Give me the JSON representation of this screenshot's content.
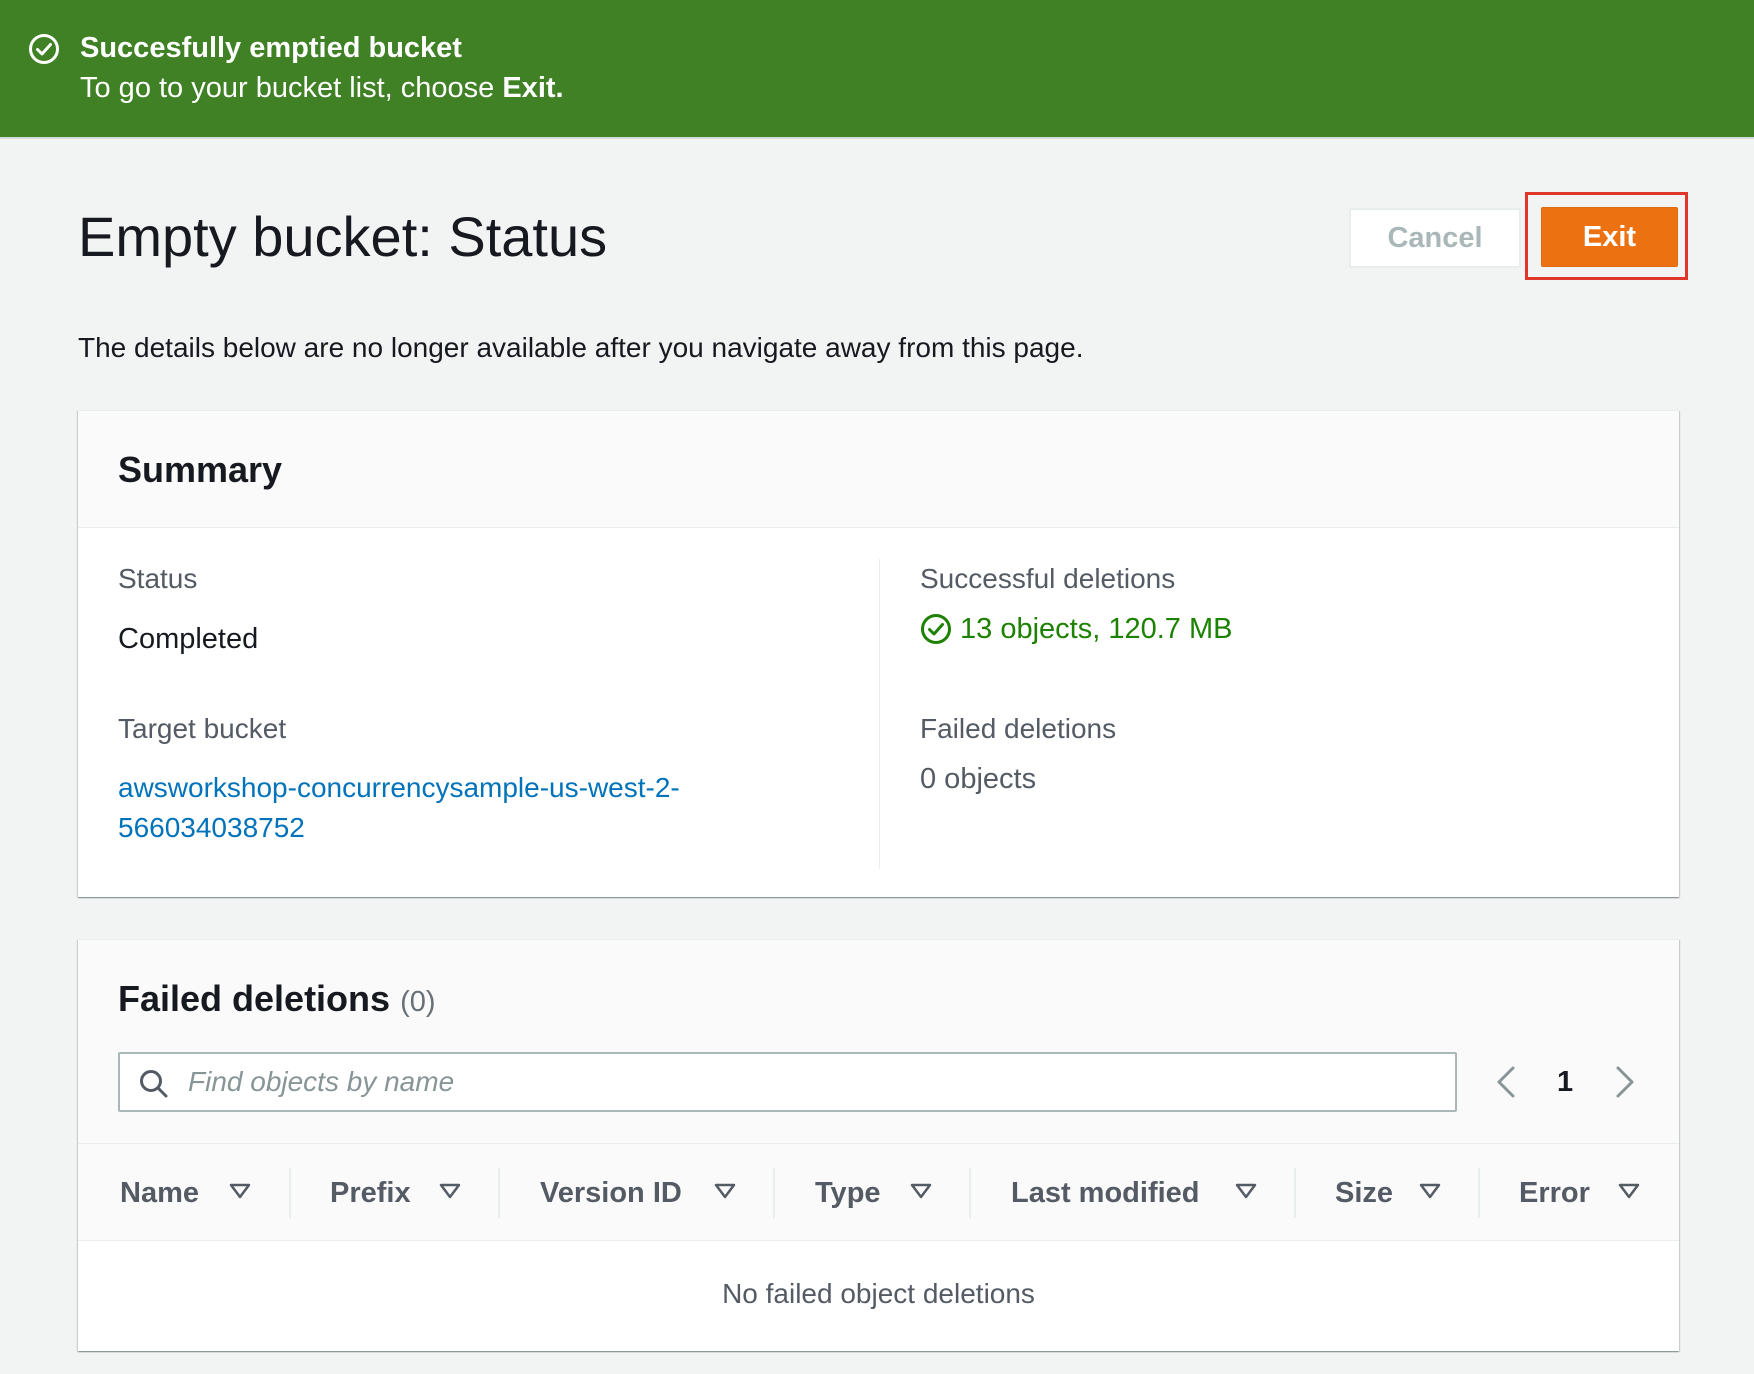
{
  "flash": {
    "title": "Succesfully emptied bucket",
    "message_prefix": "To go to your bucket list, choose ",
    "message_emphasis": "Exit."
  },
  "header": {
    "title": "Empty bucket: Status",
    "cancel_label": "Cancel",
    "exit_label": "Exit",
    "description": "The details below are no longer available after you navigate away from this page."
  },
  "summary": {
    "heading": "Summary",
    "status_label": "Status",
    "status_value": "Completed",
    "target_label": "Target bucket",
    "target_line1": "awsworkshop-concurrencysample-us-west-2-",
    "target_line2": "566034038752",
    "success_label": "Successful deletions",
    "success_value": "13 objects, 120.7 MB",
    "failed_label": "Failed deletions",
    "failed_value": "0 objects"
  },
  "failed_table": {
    "heading": "Failed deletions",
    "count": "(0)",
    "search_placeholder": "Find objects by name",
    "page": "1",
    "columns": [
      "Name",
      "Prefix",
      "Version ID",
      "Type",
      "Last modified",
      "Size",
      "Error"
    ],
    "empty_message": "No failed object deletions"
  },
  "colors": {
    "flash_success": "#3f8124",
    "primary_button": "#ec7211",
    "highlight_outline": "#e0352b",
    "success_text": "#1d8102",
    "link": "#0073bb"
  },
  "icons": {
    "flash": "check-circle-icon",
    "success": "check-circle-icon",
    "search": "search-icon",
    "prev": "chevron-left-icon",
    "next": "chevron-right-icon",
    "sort": "caret-down-icon"
  }
}
